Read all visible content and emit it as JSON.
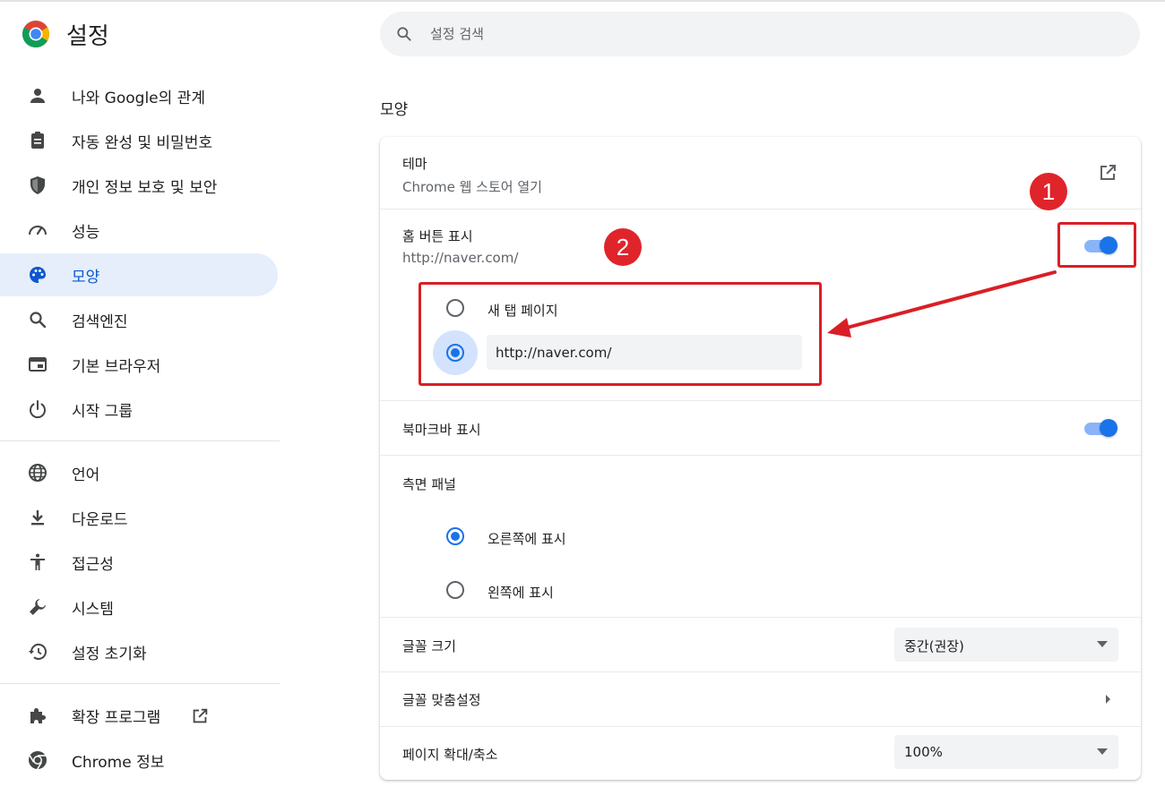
{
  "app": {
    "title": "설정"
  },
  "search": {
    "placeholder": "설정 검색"
  },
  "sidebar": {
    "items": [
      {
        "label": "나와 Google의 관계",
        "icon": "person-icon"
      },
      {
        "label": "자동 완성 및 비밀번호",
        "icon": "clipboard-icon"
      },
      {
        "label": "개인 정보 보호 및 보안",
        "icon": "shield-icon"
      },
      {
        "label": "성능",
        "icon": "speedometer-icon"
      },
      {
        "label": "모양",
        "icon": "palette-icon",
        "active": true
      },
      {
        "label": "검색엔진",
        "icon": "search-icon"
      },
      {
        "label": "기본 브라우저",
        "icon": "browser-icon"
      },
      {
        "label": "시작 그룹",
        "icon": "power-icon"
      },
      {
        "label": "언어",
        "icon": "globe-icon"
      },
      {
        "label": "다운로드",
        "icon": "download-icon"
      },
      {
        "label": "접근성",
        "icon": "accessibility-icon"
      },
      {
        "label": "시스템",
        "icon": "wrench-icon"
      },
      {
        "label": "설정 초기화",
        "icon": "history-icon"
      },
      {
        "label": "확장 프로그램",
        "icon": "puzzle-icon"
      },
      {
        "label": "Chrome 정보",
        "icon": "chrome-icon"
      }
    ]
  },
  "main": {
    "section_title": "모양",
    "theme": {
      "label": "테마",
      "sublabel": "Chrome 웹 스토어 열기",
      "icon": "open-in-new-icon"
    },
    "home_button": {
      "label": "홈 버튼 표시",
      "sublabel": "http://naver.com/",
      "enabled": true,
      "options": {
        "new_tab": {
          "label": "새 탭 페이지",
          "selected": false
        },
        "custom_url": {
          "value": "http://naver.com/",
          "selected": true
        }
      }
    },
    "bookmarks_bar": {
      "label": "북마크바 표시",
      "enabled": true
    },
    "side_panel": {
      "label": "측면 패널",
      "options": [
        {
          "label": "오른쪽에 표시",
          "selected": true
        },
        {
          "label": "왼쪽에 표시",
          "selected": false
        }
      ]
    },
    "font_size": {
      "label": "글꼴 크기",
      "value": "중간(권장)"
    },
    "customize_fonts": {
      "label": "글꼴 맞춤설정",
      "icon": "chevron-right-icon"
    },
    "page_zoom": {
      "label": "페이지 확대/축소",
      "value": "100%"
    }
  },
  "annotations": {
    "badge_1": "1",
    "badge_2": "2",
    "color": "#d91f26"
  },
  "colors": {
    "accent": "#1a73e8",
    "active_nav_bg": "#e6eefb",
    "active_nav_text": "#0b57d0"
  }
}
